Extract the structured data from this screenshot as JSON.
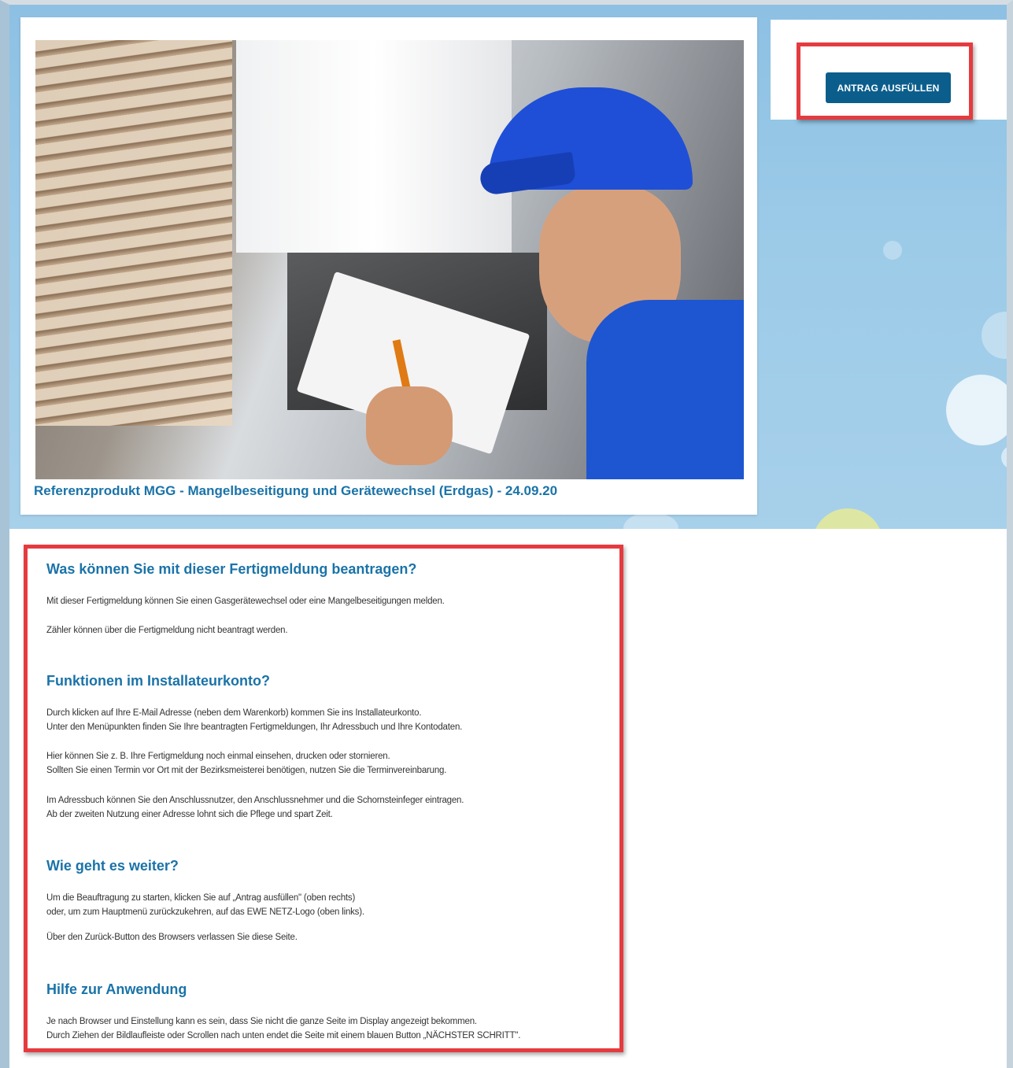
{
  "action": {
    "button_label": "ANTRAG AUSFÜLLEN"
  },
  "product": {
    "title": "Referenzprodukt MGG - Mangelbeseitigung und Gerätewechsel (Erdgas) - 24.09.20"
  },
  "info": {
    "sections": [
      {
        "heading": "Was können Sie mit dieser Fertigmeldung beantragen?",
        "paragraphs": [
          "Mit dieser Fertigmeldung können Sie einen Gasgerätewechsel oder eine Mangelbeseitigungen melden.",
          "Zähler können über die Fertigmeldung nicht beantragt werden."
        ]
      },
      {
        "heading": "Funktionen im Installateurkonto?",
        "paragraphs": [
          "Durch klicken auf Ihre E-Mail Adresse (neben dem Warenkorb) kommen Sie ins Installateurkonto.",
          "Unter den Menüpunkten finden Sie Ihre beantragten Fertigmeldungen, Ihr Adressbuch und Ihre Kontodaten.",
          "Hier können Sie z. B. Ihre Fertigmeldung noch einmal einsehen, drucken oder stornieren.",
          "Sollten Sie einen Termin vor Ort mit der Bezirksmeisterei benötigen, nutzen Sie die Terminvereinbarung.",
          "Im Adressbuch können Sie den Anschlussnutzer, den Anschlussnehmer und die Schornsteinfeger eintragen.",
          "Ab der zweiten Nutzung einer Adresse lohnt sich die Pflege und spart Zeit."
        ]
      },
      {
        "heading": "Wie geht es weiter?",
        "paragraphs": [
          "Um die Beauftragung zu starten, klicken Sie auf „Antrag ausfüllen\" (oben rechts)",
          "oder, um zum Hauptmenü zurückzukehren, auf das EWE NETZ-Logo (oben links).",
          "Über den Zurück-Button des Browsers verlassen Sie diese Seite."
        ]
      },
      {
        "heading": "Hilfe zur Anwendung",
        "paragraphs": [
          "Je nach Browser und Einstellung kann es sein, dass Sie nicht die ganze Seite im Display angezeigt bekommen.",
          "Durch Ziehen der Bildlaufleiste oder Scrollen nach unten endet die Seite mit einem blauen Button „NÄCHSTER SCHRITT\"."
        ]
      }
    ]
  },
  "colors": {
    "accent": "#1a73a8",
    "button": "#0b5e8c",
    "highlight": "#e53b3f",
    "hero_bg": "#9ccbe8"
  }
}
